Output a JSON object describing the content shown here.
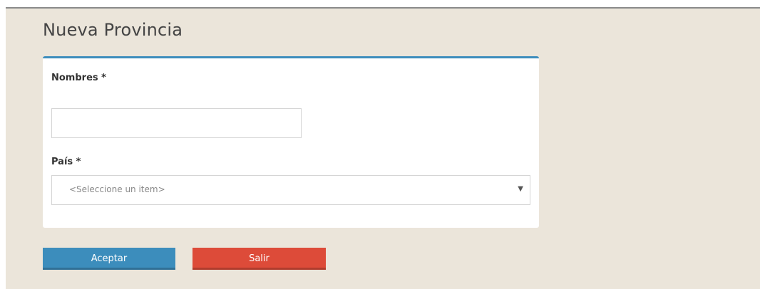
{
  "page": {
    "title": "Nueva Provincia"
  },
  "form": {
    "nombres_label": "Nombres *",
    "nombres_value": "",
    "pais_label": "País *",
    "pais_selected": "<Seleccione un item>"
  },
  "actions": {
    "accept_label": "Aceptar",
    "exit_label": "Salir"
  },
  "colors": {
    "accent": "#3c8dbc",
    "danger": "#dd4b39",
    "background": "#ebe5da"
  },
  "icons": {
    "select_arrow": "caret-down-icon"
  }
}
